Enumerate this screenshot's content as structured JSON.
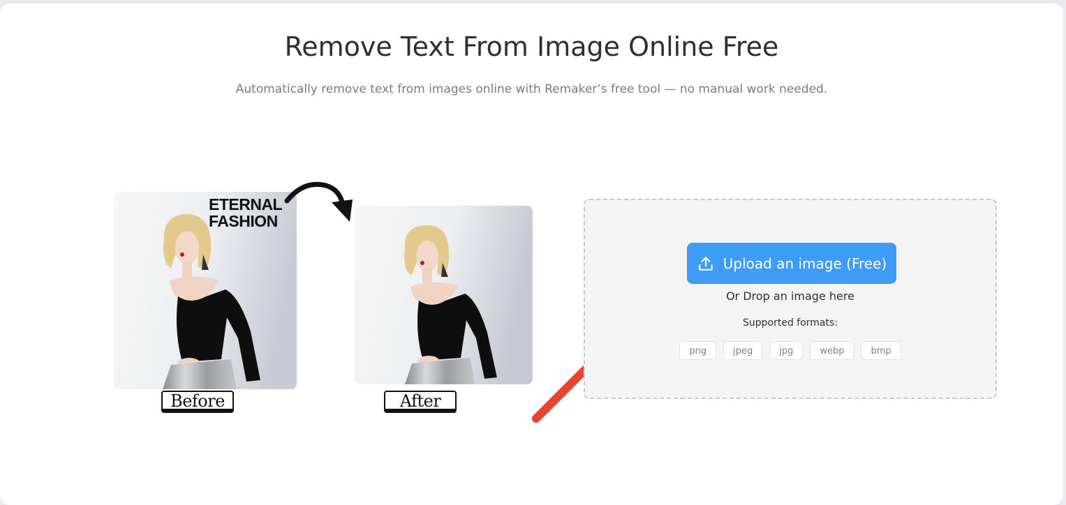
{
  "header": {
    "title": "Remove Text From Image Online Free",
    "subtitle": "Automatically remove text from images online with Remaker’s free tool — no manual work needed."
  },
  "demo": {
    "overlay_line1": "ETERNAL",
    "overlay_line2": "FASHION",
    "before_label": "Before",
    "after_label": "After"
  },
  "upload": {
    "button_label": "Upload an image (Free)",
    "button_icon": "upload-icon",
    "drop_text": "Or Drop an image here",
    "formats_label": "Supported formats:",
    "formats": [
      "png",
      "jpeg",
      "jpg",
      "webp",
      "bmp"
    ]
  },
  "colors": {
    "accent": "#3e9cf7",
    "arrow_red": "#e8432d",
    "dropzone_bg": "#f4f4f5"
  }
}
